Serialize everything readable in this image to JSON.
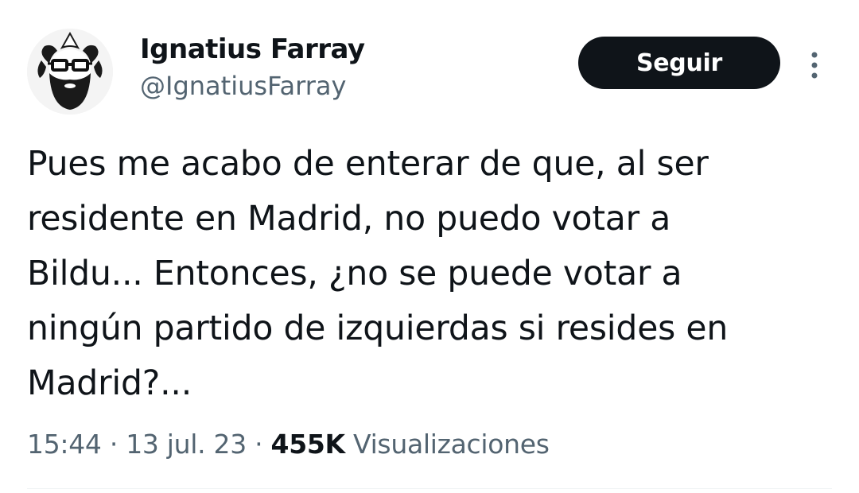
{
  "author": {
    "display_name": "Ignatius Farray",
    "handle": "@IgnatiusFarray",
    "avatar_icon": "bearded-man-glasses-avatar"
  },
  "actions": {
    "follow_label": "Seguir",
    "more_icon": "more-vertical-icon"
  },
  "tweet": {
    "lines": [
      "Pues me acabo de enterar de que, al ser",
      "residente en Madrid, no puedo votar a",
      "Bildu... Entonces, ¿no se puede votar a",
      "ningún partido de izquierdas si resides en",
      "Madrid?..."
    ]
  },
  "meta": {
    "time": "15:44",
    "separator": "·",
    "date": "13 jul. 23",
    "views_count": "455K",
    "views_label": "Visualizaciones"
  },
  "colors": {
    "text_primary": "#0f1419",
    "text_secondary": "#536471",
    "button_bg": "#0f1419",
    "button_text": "#ffffff",
    "divider": "#eff3f4"
  }
}
